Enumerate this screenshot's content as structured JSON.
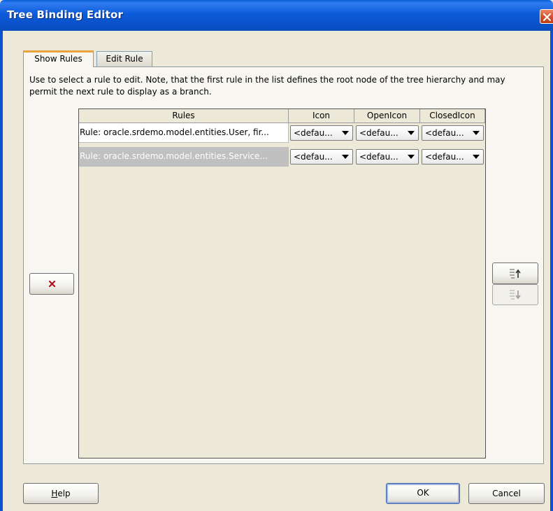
{
  "window": {
    "title": "Tree Binding Editor"
  },
  "tabs": [
    {
      "label": "Show Rules",
      "active": true
    },
    {
      "label": "Edit Rule",
      "active": false
    }
  ],
  "description": "Use to select a rule to edit. Note, that the first rule in the list defines the root node of the tree hierarchy and may permit the next rule to display as a branch.",
  "table": {
    "columns": [
      "Rules",
      "Icon",
      "OpenIcon",
      "ClosedIcon"
    ],
    "rows": [
      {
        "rule": "Rule: oracle.srdemo.model.entities.User, fir...",
        "icon": "<defau...",
        "open_icon": "<defau...",
        "closed_icon": "<defau...",
        "selected": false
      },
      {
        "rule": "Rule: oracle.srdemo.model.entities.Service...",
        "icon": "<defau...",
        "open_icon": "<defau...",
        "closed_icon": "<defau...",
        "selected": true
      }
    ]
  },
  "buttons": {
    "delete_icon": "delete-x-icon",
    "move_up_icon": "move-up-icon",
    "move_down_icon": "move-down-icon",
    "help_mnemonic": "H",
    "help_rest": "elp",
    "ok": "OK",
    "cancel": "Cancel"
  },
  "colors": {
    "titlebar": "#0A5FD8",
    "close": "#D8502D",
    "tab_accent": "#E8A33D",
    "selected_row": "#C0C0C0"
  }
}
